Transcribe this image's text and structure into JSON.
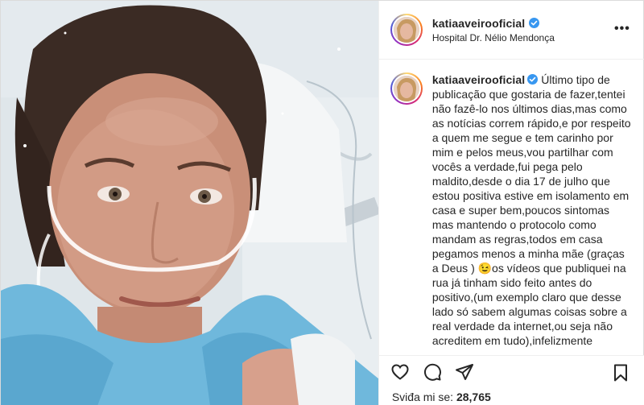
{
  "post": {
    "username": "katiaaveirooficial",
    "verified": true,
    "location": "Hospital Dr. Nélio Mendonça",
    "more_label": "•••",
    "caption": {
      "username": "katiaaveirooficial",
      "text": "Último tipo de publicação que gostaria de fazer,tentei não fazê-lo nos últimos dias,mas como as notícias correm rápido,e por respeito a quem me segue e tem carinho por mim e pelos meus,vou partilhar com vocês a verdade,fui pega pelo maldito,desde o dia 17 de julho que estou positiva estive em isolamento em casa e super bem,poucos sintomas mas mantendo o protocolo como mandam as regras,todos em casa pegamos menos a minha mãe (graças a Deus ) 😉os vídeos que publiquei na rua já tinham sido feito antes do positivo,(um exemplo claro que desse lado só sabem algumas coisas sobre a real verdade da internet,ou seja não acreditem em tudo),infelizmente"
    },
    "likes_prefix": "Sviđa mi se:",
    "likes_count": "28,765"
  },
  "icons": {
    "like": "heart-icon",
    "comment": "comment-icon",
    "share": "paper-plane-icon",
    "save": "bookmark-icon",
    "verified": "verified-badge-icon",
    "more": "more-options-icon"
  },
  "colors": {
    "verified_blue": "#3897f0",
    "text": "#262626",
    "border": "#efefef",
    "gown_blue": "#6fb8dc"
  }
}
